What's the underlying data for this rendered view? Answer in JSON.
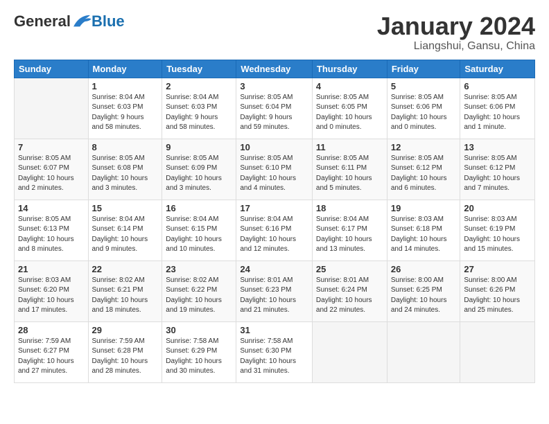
{
  "logo": {
    "general": "General",
    "blue": "Blue"
  },
  "title": "January 2024",
  "subtitle": "Liangshui, Gansu, China",
  "days_of_week": [
    "Sunday",
    "Monday",
    "Tuesday",
    "Wednesday",
    "Thursday",
    "Friday",
    "Saturday"
  ],
  "weeks": [
    [
      {
        "day": "",
        "info": ""
      },
      {
        "day": "1",
        "info": "Sunrise: 8:04 AM\nSunset: 6:03 PM\nDaylight: 9 hours\nand 58 minutes."
      },
      {
        "day": "2",
        "info": "Sunrise: 8:04 AM\nSunset: 6:03 PM\nDaylight: 9 hours\nand 58 minutes."
      },
      {
        "day": "3",
        "info": "Sunrise: 8:05 AM\nSunset: 6:04 PM\nDaylight: 9 hours\nand 59 minutes."
      },
      {
        "day": "4",
        "info": "Sunrise: 8:05 AM\nSunset: 6:05 PM\nDaylight: 10 hours\nand 0 minutes."
      },
      {
        "day": "5",
        "info": "Sunrise: 8:05 AM\nSunset: 6:06 PM\nDaylight: 10 hours\nand 0 minutes."
      },
      {
        "day": "6",
        "info": "Sunrise: 8:05 AM\nSunset: 6:06 PM\nDaylight: 10 hours\nand 1 minute."
      }
    ],
    [
      {
        "day": "7",
        "info": "Sunrise: 8:05 AM\nSunset: 6:07 PM\nDaylight: 10 hours\nand 2 minutes."
      },
      {
        "day": "8",
        "info": "Sunrise: 8:05 AM\nSunset: 6:08 PM\nDaylight: 10 hours\nand 3 minutes."
      },
      {
        "day": "9",
        "info": "Sunrise: 8:05 AM\nSunset: 6:09 PM\nDaylight: 10 hours\nand 3 minutes."
      },
      {
        "day": "10",
        "info": "Sunrise: 8:05 AM\nSunset: 6:10 PM\nDaylight: 10 hours\nand 4 minutes."
      },
      {
        "day": "11",
        "info": "Sunrise: 8:05 AM\nSunset: 6:11 PM\nDaylight: 10 hours\nand 5 minutes."
      },
      {
        "day": "12",
        "info": "Sunrise: 8:05 AM\nSunset: 6:12 PM\nDaylight: 10 hours\nand 6 minutes."
      },
      {
        "day": "13",
        "info": "Sunrise: 8:05 AM\nSunset: 6:12 PM\nDaylight: 10 hours\nand 7 minutes."
      }
    ],
    [
      {
        "day": "14",
        "info": "Sunrise: 8:05 AM\nSunset: 6:13 PM\nDaylight: 10 hours\nand 8 minutes."
      },
      {
        "day": "15",
        "info": "Sunrise: 8:04 AM\nSunset: 6:14 PM\nDaylight: 10 hours\nand 9 minutes."
      },
      {
        "day": "16",
        "info": "Sunrise: 8:04 AM\nSunset: 6:15 PM\nDaylight: 10 hours\nand 10 minutes."
      },
      {
        "day": "17",
        "info": "Sunrise: 8:04 AM\nSunset: 6:16 PM\nDaylight: 10 hours\nand 12 minutes."
      },
      {
        "day": "18",
        "info": "Sunrise: 8:04 AM\nSunset: 6:17 PM\nDaylight: 10 hours\nand 13 minutes."
      },
      {
        "day": "19",
        "info": "Sunrise: 8:03 AM\nSunset: 6:18 PM\nDaylight: 10 hours\nand 14 minutes."
      },
      {
        "day": "20",
        "info": "Sunrise: 8:03 AM\nSunset: 6:19 PM\nDaylight: 10 hours\nand 15 minutes."
      }
    ],
    [
      {
        "day": "21",
        "info": "Sunrise: 8:03 AM\nSunset: 6:20 PM\nDaylight: 10 hours\nand 17 minutes."
      },
      {
        "day": "22",
        "info": "Sunrise: 8:02 AM\nSunset: 6:21 PM\nDaylight: 10 hours\nand 18 minutes."
      },
      {
        "day": "23",
        "info": "Sunrise: 8:02 AM\nSunset: 6:22 PM\nDaylight: 10 hours\nand 19 minutes."
      },
      {
        "day": "24",
        "info": "Sunrise: 8:01 AM\nSunset: 6:23 PM\nDaylight: 10 hours\nand 21 minutes."
      },
      {
        "day": "25",
        "info": "Sunrise: 8:01 AM\nSunset: 6:24 PM\nDaylight: 10 hours\nand 22 minutes."
      },
      {
        "day": "26",
        "info": "Sunrise: 8:00 AM\nSunset: 6:25 PM\nDaylight: 10 hours\nand 24 minutes."
      },
      {
        "day": "27",
        "info": "Sunrise: 8:00 AM\nSunset: 6:26 PM\nDaylight: 10 hours\nand 25 minutes."
      }
    ],
    [
      {
        "day": "28",
        "info": "Sunrise: 7:59 AM\nSunset: 6:27 PM\nDaylight: 10 hours\nand 27 minutes."
      },
      {
        "day": "29",
        "info": "Sunrise: 7:59 AM\nSunset: 6:28 PM\nDaylight: 10 hours\nand 28 minutes."
      },
      {
        "day": "30",
        "info": "Sunrise: 7:58 AM\nSunset: 6:29 PM\nDaylight: 10 hours\nand 30 minutes."
      },
      {
        "day": "31",
        "info": "Sunrise: 7:58 AM\nSunset: 6:30 PM\nDaylight: 10 hours\nand 31 minutes."
      },
      {
        "day": "",
        "info": ""
      },
      {
        "day": "",
        "info": ""
      },
      {
        "day": "",
        "info": ""
      }
    ]
  ]
}
